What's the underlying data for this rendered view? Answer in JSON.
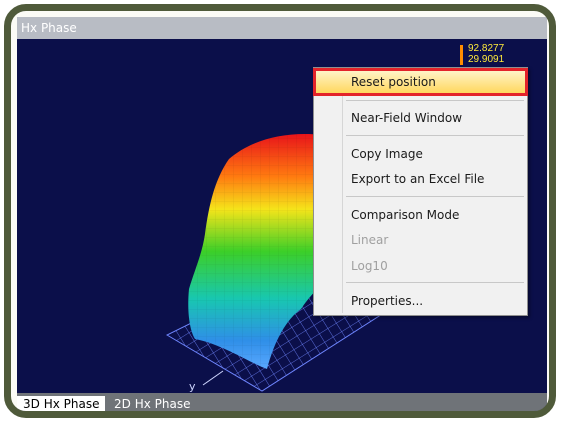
{
  "window": {
    "title": "Hx Phase"
  },
  "colorbar": {
    "max_label": "92.8277",
    "second_label": "29.9091"
  },
  "axis": {
    "y_label": "y"
  },
  "context_menu": {
    "items": [
      {
        "label": "Reset position",
        "enabled": true,
        "highlighted": true
      },
      {
        "label": "Near-Field Window",
        "enabled": true
      },
      {
        "label": "Copy Image",
        "enabled": true
      },
      {
        "label": "Export to an Excel File",
        "enabled": true
      },
      {
        "label": "Comparison Mode",
        "enabled": true
      },
      {
        "label": "Linear",
        "enabled": false
      },
      {
        "label": "Log10",
        "enabled": false
      },
      {
        "label": "Properties...",
        "enabled": true
      }
    ]
  },
  "tabs": [
    {
      "label": "3D Hx Phase",
      "active": true
    },
    {
      "label": "2D Hx Phase",
      "active": false
    }
  ],
  "colors": {
    "plot_background": "#0b0f4a",
    "highlight_outline": "#e3232a",
    "colorbar_text": "#ffeb3b"
  }
}
